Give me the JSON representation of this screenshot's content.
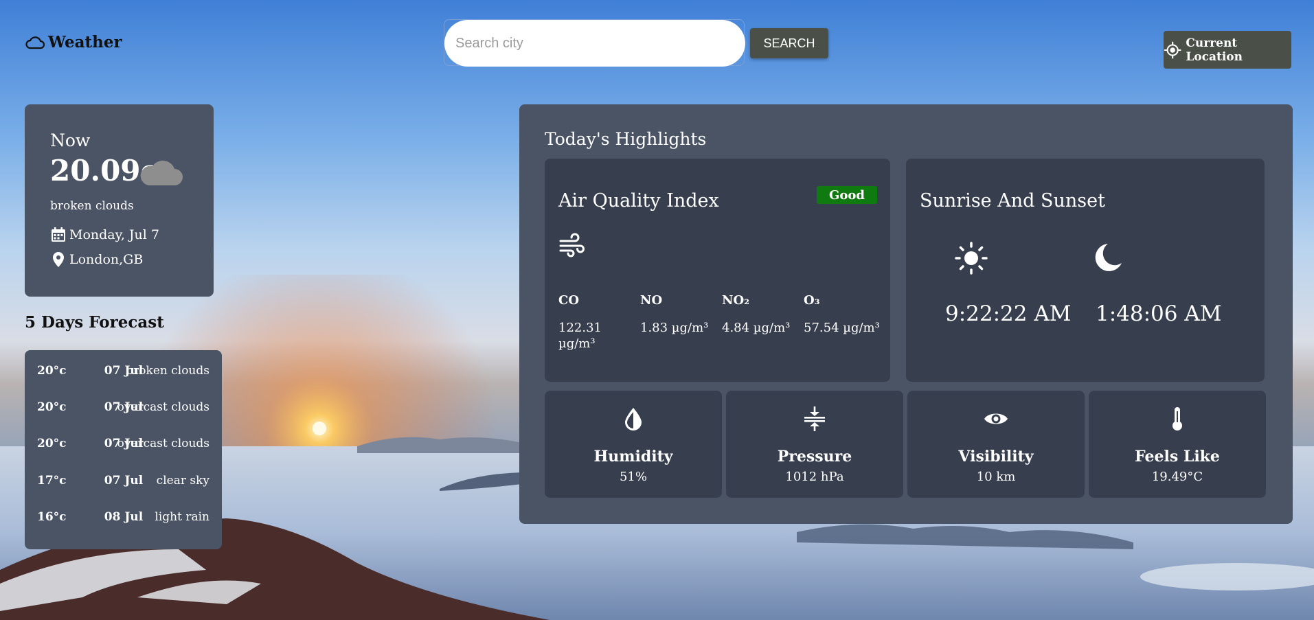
{
  "header": {
    "logo_text": "Weather",
    "search": {
      "placeholder": "Search city",
      "button_label": "SEARCH"
    },
    "location_button_label": "Current Location"
  },
  "now": {
    "label": "Now",
    "temperature": "20.09c",
    "description": "broken clouds",
    "date": "Monday, Jul 7",
    "location": "London,GB"
  },
  "forecast": {
    "title": "5 Days Forecast",
    "days": [
      {
        "temp": "20°c",
        "date": "07 Jul",
        "desc": "broken clouds"
      },
      {
        "temp": "20°c",
        "date": "07 Jul",
        "desc": "overcast clouds"
      },
      {
        "temp": "20°c",
        "date": "07 Jul",
        "desc": "overcast clouds"
      },
      {
        "temp": "17°c",
        "date": "07 Jul",
        "desc": "clear sky"
      },
      {
        "temp": "16°c",
        "date": "08 Jul",
        "desc": "light rain"
      }
    ]
  },
  "highlights": {
    "title": "Today's Highlights",
    "aqi": {
      "title": "Air Quality Index",
      "badge": "Good",
      "badge_color": "#0f7a0f",
      "pollutants": [
        {
          "name": "CO",
          "value": "122.31 µg/m³"
        },
        {
          "name": "NO",
          "value": "1.83 µg/m³"
        },
        {
          "name": "NO₂",
          "value": "4.84 µg/m³"
        },
        {
          "name": "O₃",
          "value": "57.54 µg/m³"
        }
      ]
    },
    "sun": {
      "title": "Sunrise And Sunset",
      "sunrise": "9:22:22 AM",
      "sunset": "1:48:06 AM"
    },
    "stats": [
      {
        "name": "Humidity",
        "value": "51%",
        "icon": "water-drop-icon"
      },
      {
        "name": "Pressure",
        "value": "1012 hPa",
        "icon": "compress-icon"
      },
      {
        "name": "Visibility",
        "value": "10 km",
        "icon": "eye-icon"
      },
      {
        "name": "Feels Like",
        "value": "19.49°C",
        "icon": "thermometer-icon"
      }
    ]
  },
  "colors": {
    "card": "#4b5465",
    "inner_card": "#373e4e",
    "button": "#4a5048"
  }
}
